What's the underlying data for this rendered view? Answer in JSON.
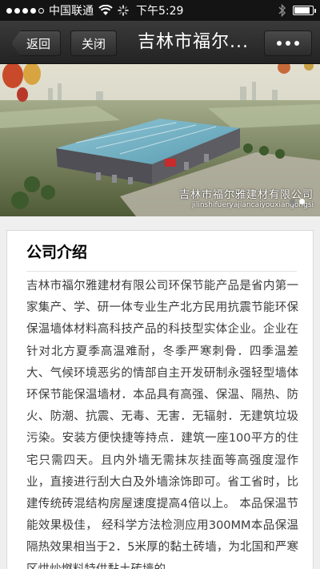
{
  "status_bar": {
    "carrier": "中国联通",
    "time": "下午5:29"
  },
  "nav": {
    "back_label": "返回",
    "close_label": "关闭",
    "title": "吉林市福尔..."
  },
  "banner": {
    "caption_cn": "吉林市福尔雅建材有限公司",
    "caption_pinyin": "jilinshifueryajiancaiyouxiangongsi",
    "slide_count": 2,
    "active_slide": 2
  },
  "article": {
    "heading": "公司介绍",
    "body": "吉林市福尔雅建材有限公司环保节能产品是省内第一家集产、学、研一体专业生产北方民用抗震节能环保保温墙体材料高科技产品的科技型实体企业。企业在针对北方夏季高温难耐，冬季严寒刺骨．四季温差大、气候环境恶劣的情部自主开发研制永强轻型墙体环保节能保温墙材．本品具有高强、保温、隔热、防火、防潮、抗震、无毒、无害．无辐射．无建筑垃圾污染。安装方便快捷等持点．建筑一座100平方的住宅只需四天。且内外墙无需抹灰挂面等高强度湿作业，直接进行刮大白及外墙涂饰即可。省工省时，比建传统砖混结构房屋速度提高4倍以上。 本品保温节能效果极佳， 经科学方法检测应用300MM本品保温隔热效果相当于2．5米厚的黏土砖墙，为北国和严寒区烘炒燃料特供黏土砖墙的"
  }
}
